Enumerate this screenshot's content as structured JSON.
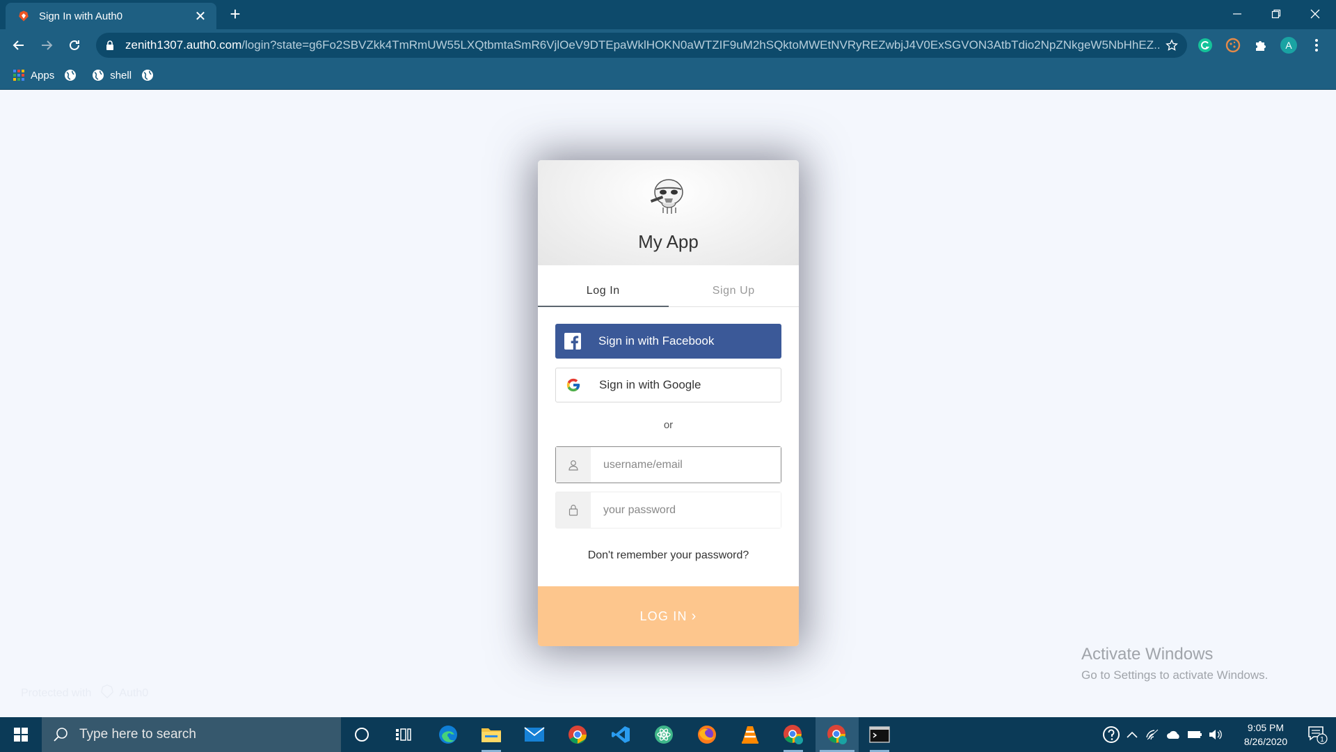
{
  "browser": {
    "tab": {
      "title": "Sign In with Auth0",
      "close": "✕"
    },
    "new_tab": "+",
    "url": {
      "host": "zenith1307.auth0.com",
      "path": "/login?state=g6Fo2SBVZkk4TmRmUW55LXQtbmtaSmR6VjlOeV9DTEpaWklHOKN0aWTZIF9uM2hSQktoMWEtNVRyREZwbjJ4V0ExSGVON3AtbTdio2NpZNkgeW5NbHhEZ..."
    },
    "profile_initial": "A",
    "bookmarks": [
      {
        "label": "Apps"
      },
      {
        "label": ""
      },
      {
        "label": "shell"
      },
      {
        "label": ""
      }
    ]
  },
  "login": {
    "app_name": "My App",
    "tabs": [
      {
        "label": "Log In",
        "active": true
      },
      {
        "label": "Sign Up",
        "active": false
      }
    ],
    "facebook_label": "Sign in with Facebook",
    "google_label": "Sign in with Google",
    "or_text": "or",
    "username_placeholder": "username/email",
    "password_placeholder": "your password",
    "forgot_text": "Don't remember your password?",
    "submit_label": "LOG IN",
    "submit_chevron": "›"
  },
  "footer": {
    "protected_text": "Protected with",
    "brand": "Auth0"
  },
  "watermark": {
    "title": "Activate Windows",
    "subtitle": "Go to Settings to activate Windows."
  },
  "taskbar": {
    "search_placeholder": "Type here to search",
    "time": "9:05 PM",
    "date": "8/26/2020",
    "notification_count": "1"
  },
  "colors": {
    "facebook": "#3b5998",
    "login_button": "#fdc68d",
    "chrome_frame": "#0d4a6b",
    "chrome_toolbar": "#1e5f82",
    "taskbar": "#0b3a57"
  }
}
